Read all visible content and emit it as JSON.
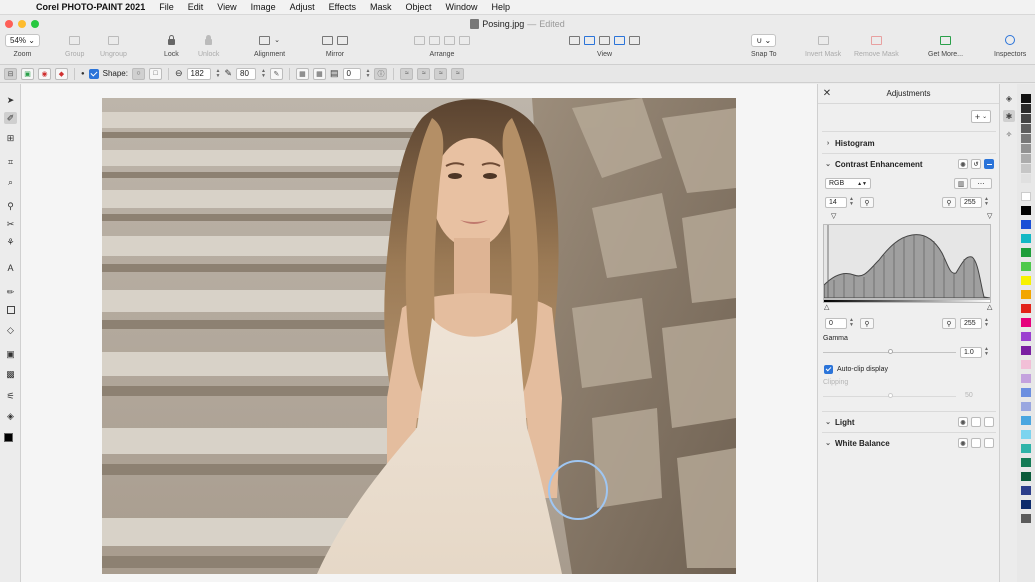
{
  "menubar": {
    "app_name": "Corel PHOTO-PAINT 2021",
    "items": [
      "File",
      "Edit",
      "View",
      "Image",
      "Adjust",
      "Effects",
      "Mask",
      "Object",
      "Window",
      "Help"
    ]
  },
  "window": {
    "doc_name": "Posing.jpg",
    "separator": "—",
    "doc_status": "Edited"
  },
  "toolbar": {
    "zoom_value": "54%",
    "zoom_label": "Zoom",
    "group_label": "Group",
    "ungroup_label": "Ungroup",
    "lock_label": "Lock",
    "unlock_label": "Unlock",
    "alignment_label": "Alignment",
    "mirror_label": "Mirror",
    "arrange_label": "Arrange",
    "view_label": "View",
    "snap_label": "Snap To",
    "invert_mask_label": "Invert Mask",
    "remove_mask_label": "Remove Mask",
    "get_more_label": "Get More...",
    "inspectors_label": "Inspectors"
  },
  "propbar": {
    "shape_label": "Shape:",
    "size_value": "182",
    "transparency_value": "80",
    "rotation_value": "0"
  },
  "panel": {
    "title": "Adjustments",
    "add_label": "+",
    "histogram_label": "Histogram",
    "contrast_label": "Contrast Enhancement",
    "channel_value": "RGB",
    "input_low": "14",
    "input_high": "255",
    "output_low": "0",
    "output_high": "255",
    "gamma_label": "Gamma",
    "gamma_value": "1.0",
    "autoclip_label": "Auto-clip display",
    "clipping_label": "Clipping",
    "clipping_value": "50",
    "light_label": "Light",
    "white_balance_label": "White Balance"
  },
  "colors": {
    "accent": "#2b74d9",
    "palette": [
      "#ffffff",
      "#000000",
      "#1a4fd6",
      "#14b8c4",
      "#1e9e3a",
      "#4ec94b",
      "#f7f200",
      "#f2a600",
      "#e2231a",
      "#e6007e",
      "#9b3fd0",
      "#7a1fa2",
      "#f2bfd7",
      "#c4a2de",
      "#6c8fe0",
      "#9aa7e0",
      "#4aa6e0",
      "#7cd4ef",
      "#2fb3a8",
      "#147a55",
      "#0b5b3a",
      "#2c3e8a",
      "#0d2b6b",
      "#5b5b5b"
    ]
  }
}
